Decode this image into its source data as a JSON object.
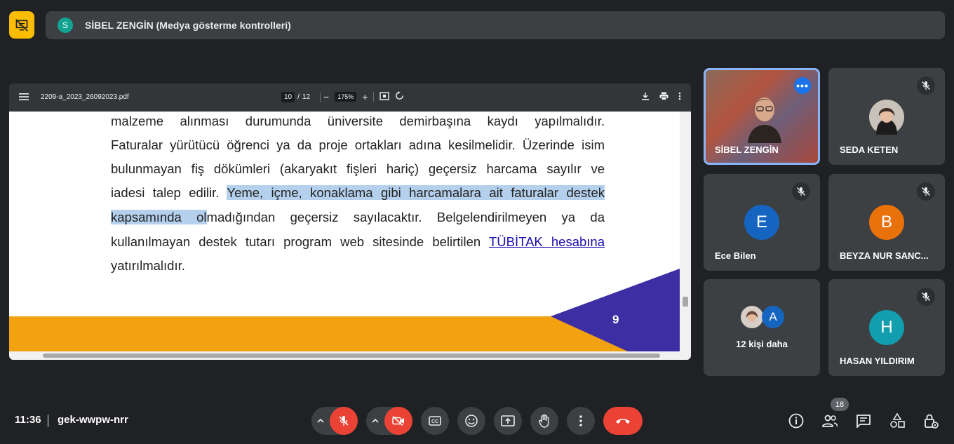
{
  "meeting": {
    "presenter_initial": "S",
    "presenter_title": "SİBEL ZENGİN (Medya gösterme kontrolleri)",
    "time": "11:36",
    "code": "gek-wwpw-nrr",
    "participant_count": "18"
  },
  "pdf": {
    "filename": "2209-a_2023_26092023.pdf",
    "page_current": "10",
    "page_separator": "/",
    "page_total": "12",
    "zoom": "175%",
    "lines": [
      "malzeme alınması durumunda üniversite demirbaşına kaydı yapılmalıdır.",
      "Faturalar yürütücü öğrenci ya da proje ortakları adına kesilmelidir. Üzerinde isim",
      "bulunmayan fiş dökümleri (akaryakıt fişleri hariç) geçersiz harcama sayılır ve"
    ],
    "line4_plain": "iadesi talep edilir. ",
    "line4_highlight": "Yeme, içme, konaklama gibi harcamalara ait faturalar destek",
    "line5_highlight": "kapsamında ol",
    "line5_plain": "madığından geçersiz sayılacaktır. Belgelendirilmeyen ya da",
    "line6_plain": "kullanılmayan destek tutarı program web sitesinde belirtilen ",
    "line6_link": "TÜBİTAK hesabına",
    "line7": "yatırılmalıdır.",
    "slide_number": "9"
  },
  "participants": [
    {
      "name": "SİBEL ZENGİN",
      "type": "video"
    },
    {
      "name": "SEDA KETEN",
      "type": "photo"
    },
    {
      "name": "Ece Bilen",
      "initial": "E",
      "color": "#1565c0"
    },
    {
      "name": "BEYZA NUR SANC...",
      "initial": "B",
      "color": "#e8710a"
    },
    {
      "name": "12 kişi daha",
      "initial": "A",
      "color": "#1565c0"
    },
    {
      "name": "HASAN YILDIRIM",
      "initial": "H",
      "color": "#129eaf"
    }
  ],
  "colors": {
    "accent": "#8ab4f8",
    "present": "#fbbc04",
    "danger": "#ea4335",
    "highlight": "#b4d0ec",
    "slide_purple": "#3d2ea3",
    "slide_orange": "#f2a111"
  },
  "icons": {
    "present": "presentation-off-icon",
    "mic": "mic-off-icon",
    "camera": "videocam-off-icon",
    "captions": "closed-caption-icon",
    "emoji": "emoji-icon",
    "share": "present-screen-icon",
    "hand": "raise-hand-icon",
    "more": "more-vert-icon",
    "end": "call-end-icon",
    "info": "info-icon",
    "people": "people-icon",
    "chat": "chat-icon",
    "activities": "activities-icon",
    "lock": "host-controls-icon"
  }
}
